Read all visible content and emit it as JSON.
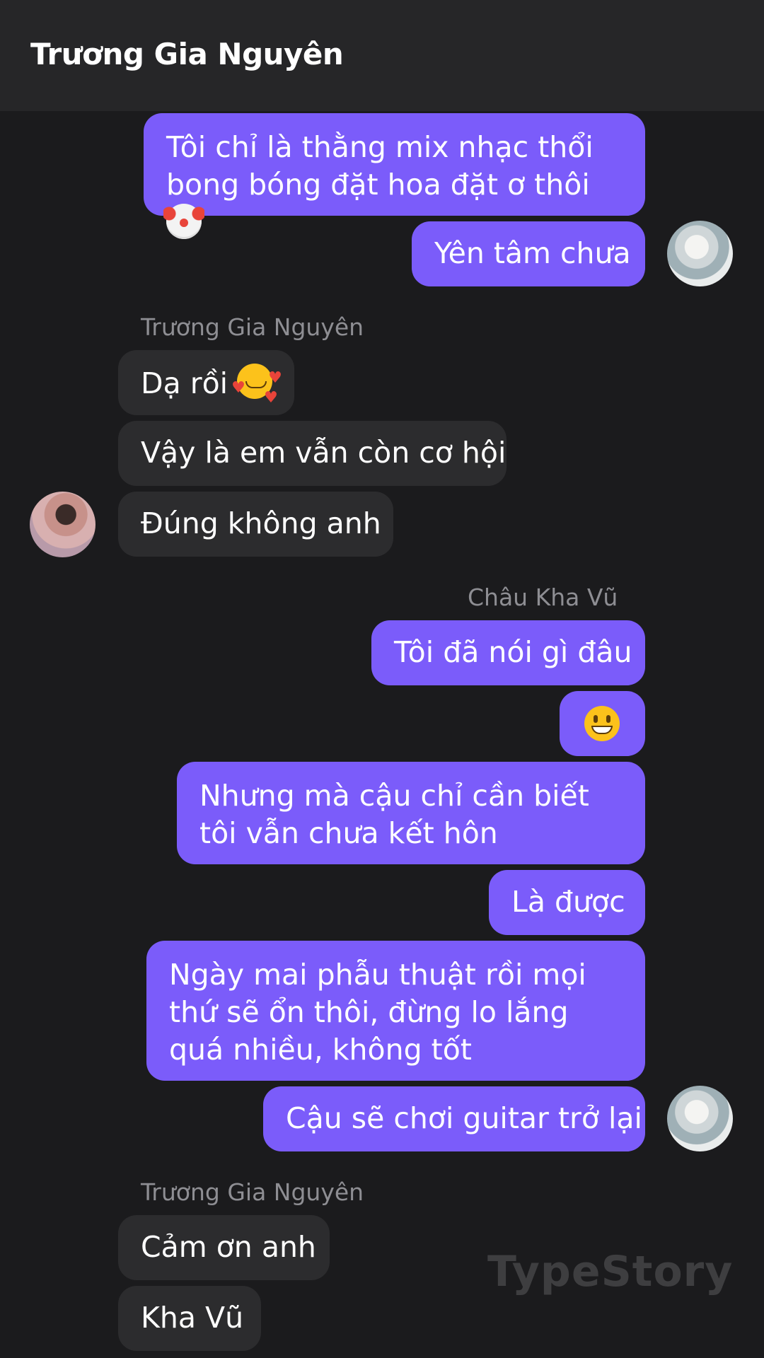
{
  "header": {
    "title": "Trương Gia Nguyên"
  },
  "messages": {
    "m1": "Tôi chỉ là thằng mix nhạc thổi bong bóng đặt hoa đặt ơ thôi",
    "m2": "Yên tâm chưa",
    "sender1": "Trương Gia Nguyên",
    "m3": "Dạ rồi",
    "m4": "Vậy là em vẫn còn cơ hội",
    "m5": "Đúng không anh",
    "sender2": "Châu Kha Vũ",
    "m6": "Tôi đã nói gì đâu",
    "m8": "Nhưng mà cậu chỉ cần biết tôi vẫn chưa kết hôn",
    "m9": "Là được",
    "m10": "Ngày mai phẫu thuật rồi mọi thứ sẽ ổn thôi, đừng lo lắng quá nhiều, không tốt",
    "m11": "Cậu sẽ chơi guitar trở lại",
    "sender3": "Trương Gia Nguyên",
    "m12": "Cảm ơn anh",
    "m13": "Kha Vũ"
  },
  "emojis": {
    "clown": "clown-face-emoji",
    "smile": "grinning-face-emoji",
    "hearts": "smiling-face-with-hearts-emoji"
  },
  "watermark": "TypeStory",
  "colors": {
    "background": "#1b1b1d",
    "header": "#262628",
    "outgoing_bubble": "#7b5cfa",
    "incoming_bubble": "#2c2c2e",
    "sender_label": "#8e8e93"
  }
}
